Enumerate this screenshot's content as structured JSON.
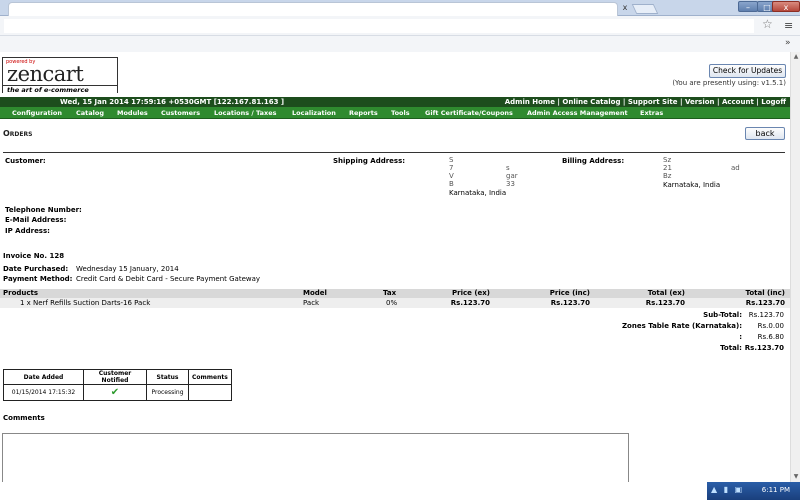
{
  "browser": {
    "tab_close": "x",
    "win_min": "–",
    "win_max": "□",
    "win_close": "x",
    "star": "☆",
    "menu": "≡",
    "bookmark_chevron": "»"
  },
  "header": {
    "logo_powered": "powered by",
    "logo_main": "zencart",
    "logo_tag": "the art of e-commerce",
    "check_updates": "Check for Updates",
    "version_note": "(You are presently using: v1.5.1)"
  },
  "topbar": {
    "date": "Wed, 15 Jan 2014 17:59:16 +0530GMT [122.167.81.163 ]",
    "links": "Admin Home |  Online Catalog |  Support Site |  Version |  Account |  Logoff"
  },
  "menu": [
    "Configuration",
    "Catalog",
    "Modules",
    "Customers",
    "Locations / Taxes",
    "Localization",
    "Reports",
    "Tools",
    "Gift Certificate/Coupons",
    "Admin Access Management",
    "Extras"
  ],
  "page": {
    "title": "Orders",
    "back": "back"
  },
  "addresses": {
    "customer_label": "Customer:",
    "shipping_label": "Shipping Address:",
    "billing_label": "Billing Address:",
    "shipping_lines": [
      "S",
      "7",
      "V",
      "B",
      "Karnataka, India"
    ],
    "shipping_frag": [
      "s",
      "gar",
      "33"
    ],
    "billing_lines": [
      "Sz",
      "21",
      "Bz",
      "Karnataka, India"
    ],
    "billing_frag": [
      "ad"
    ],
    "telephone_label": "Telephone Number:",
    "email_label": "E-Mail Address:",
    "ip_label": "IP Address:"
  },
  "order": {
    "invoice": "Invoice No. 128",
    "date_label": "Date Purchased:",
    "date_value": "Wednesday 15 January, 2014",
    "payment_label": "Payment Method:",
    "payment_value": "Credit Card & Debit Card - Secure Payment Gateway"
  },
  "products": {
    "headers": [
      "Products",
      "Model",
      "Tax",
      "Price (ex)",
      "Price (inc)",
      "Total (ex)",
      "Total (inc)"
    ],
    "rows": [
      {
        "product": "1 x Nerf Refills Suction Darts-16 Pack",
        "model": "Pack",
        "tax": "0%",
        "price_ex": "Rs.123.70",
        "price_inc": "Rs.123.70",
        "total_ex": "Rs.123.70",
        "total_inc": "Rs.123.70"
      }
    ]
  },
  "totals": [
    {
      "label": "Sub-Total:",
      "value": "Rs.123.70"
    },
    {
      "label": "Zones Table Rate (Karnataka):",
      "value": "Rs.0.00"
    },
    {
      "label": ":",
      "value": "Rs.6.80"
    },
    {
      "label": "Total:",
      "value": "Rs.123.70"
    }
  ],
  "history": {
    "headers": [
      "Date Added",
      "Customer Notified",
      "Status",
      "Comments"
    ],
    "rows": [
      {
        "date": "01/15/2014 17:15:32",
        "status": "Processing",
        "comments": ""
      }
    ]
  },
  "comments_label": "Comments",
  "taskbar": {
    "time": "6:11 PM",
    "tray_icons": "▲ ▮ ▣"
  }
}
